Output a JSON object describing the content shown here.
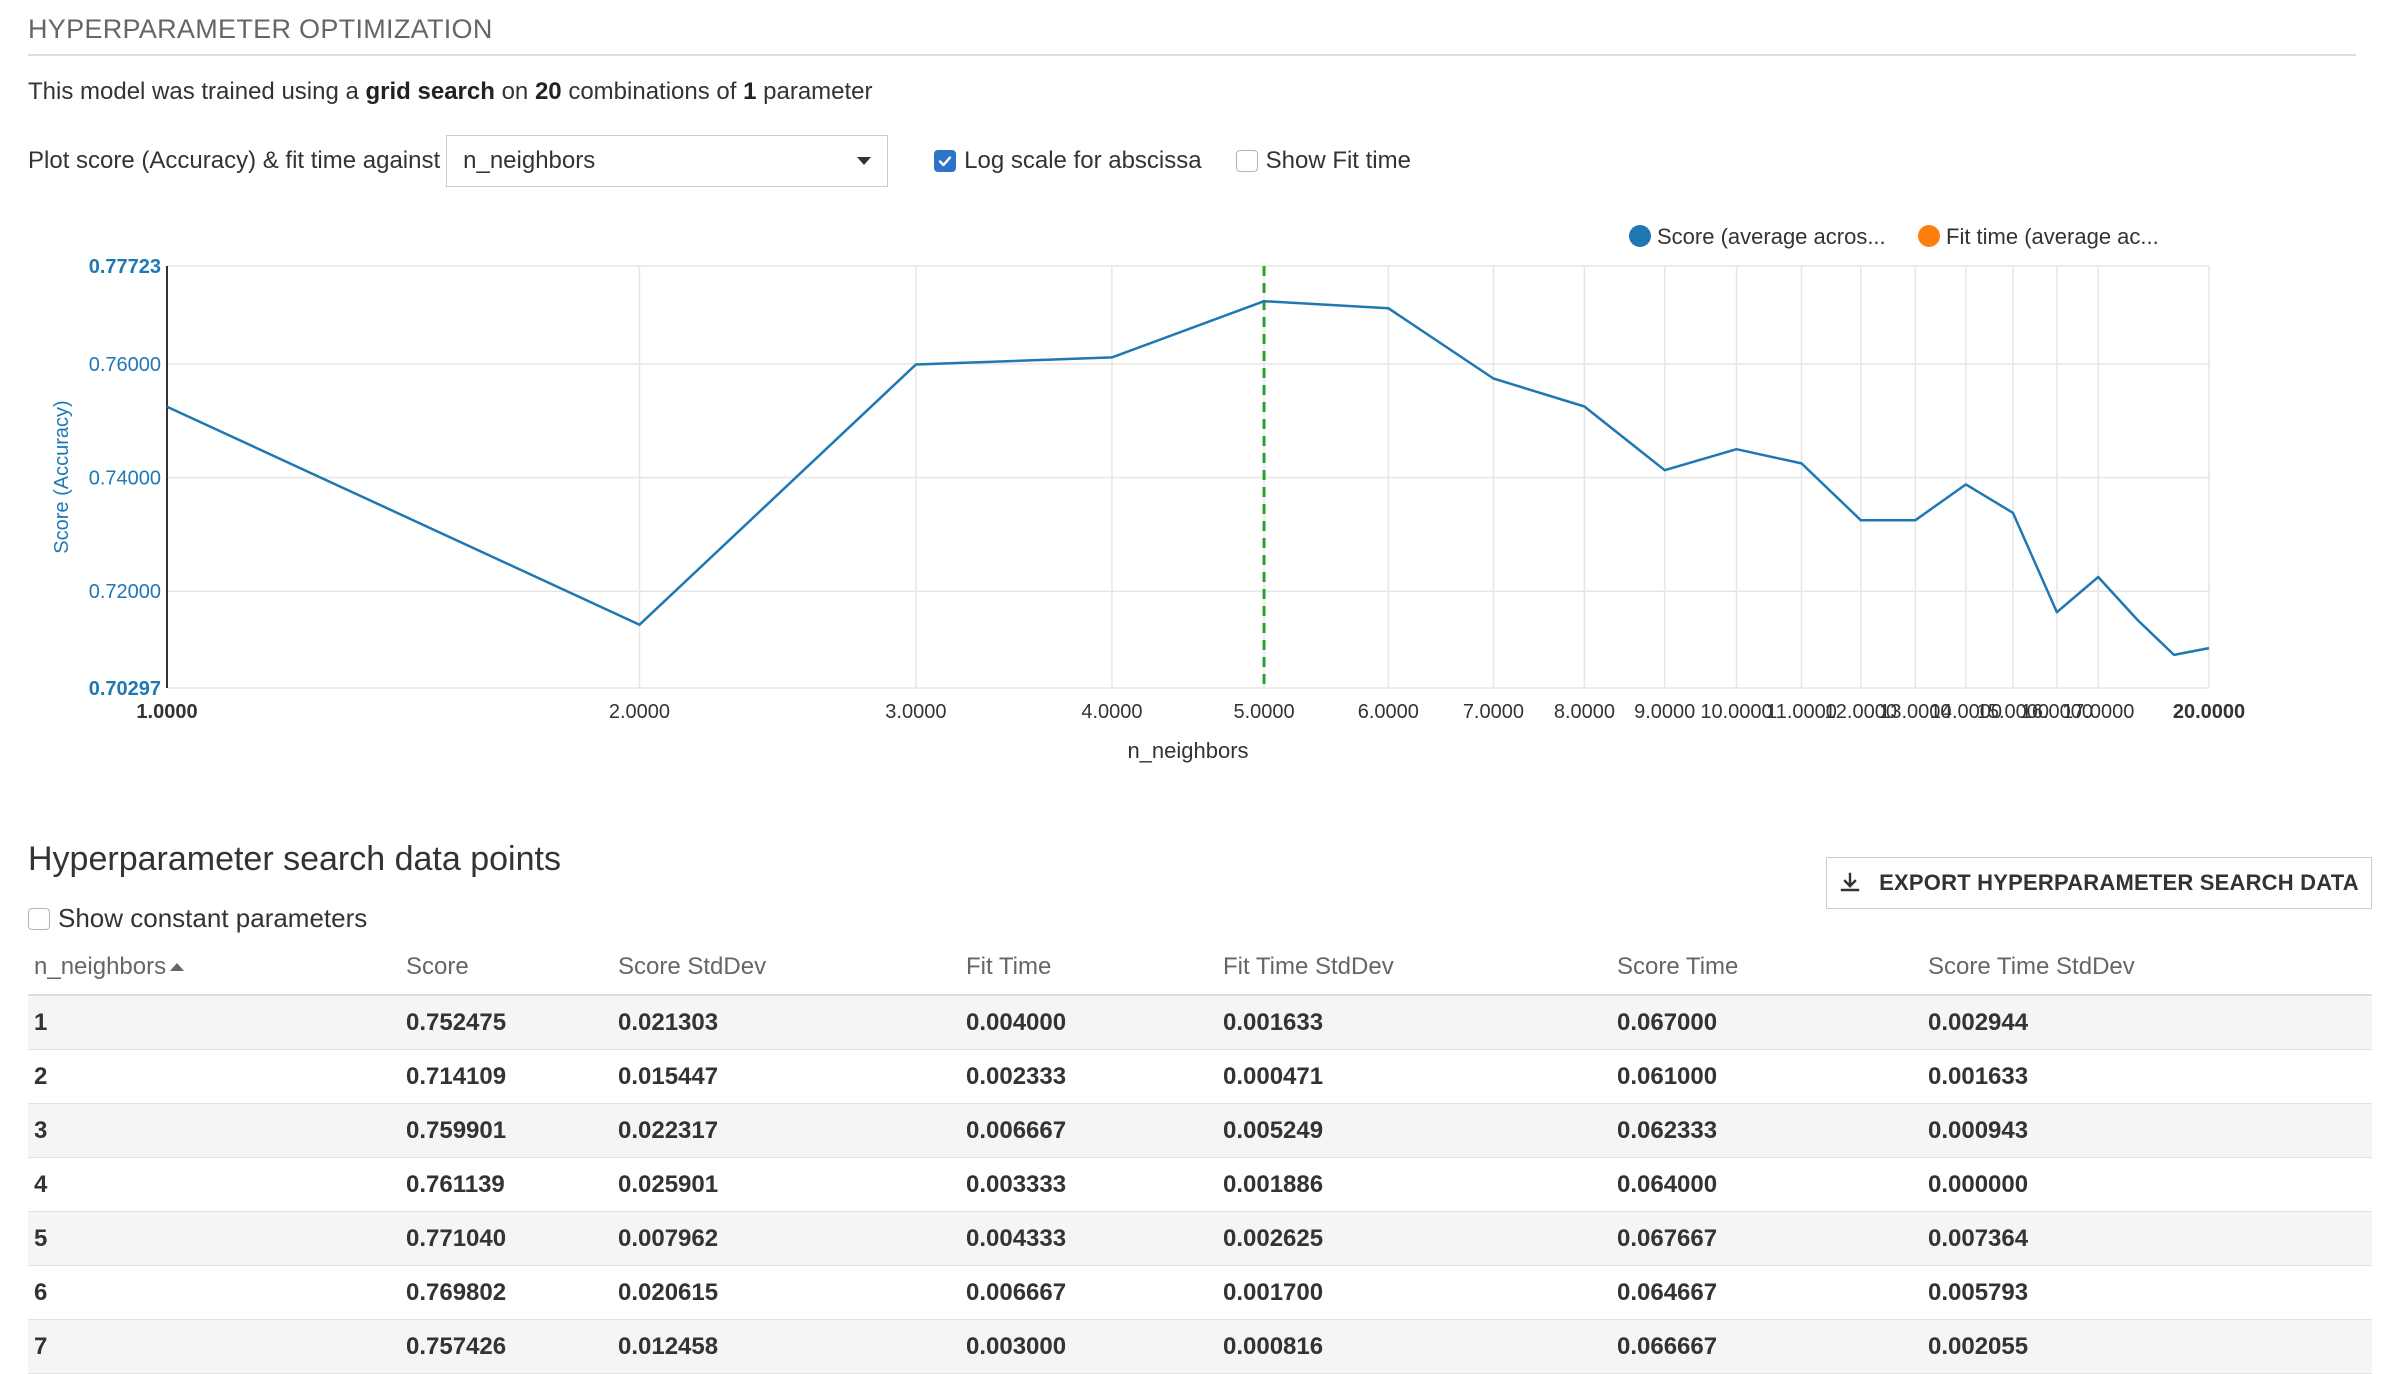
{
  "section_title": "HYPERPARAMETER OPTIMIZATION",
  "summary": {
    "prefix": "This model was trained using a",
    "method": "grid search",
    "on": "on",
    "combinations": "20",
    "middle": "combinations of",
    "parameters": "1",
    "suffix": "parameter"
  },
  "controls": {
    "plot_label": "Plot score (Accuracy) & fit time against",
    "selected_param": "n_neighbors",
    "log_scale_label": "Log scale for abscissa",
    "log_scale_checked": true,
    "show_fit_time_label": "Show Fit time",
    "show_fit_time_checked": false
  },
  "chart_data": {
    "type": "line",
    "xscale": "log",
    "xlabel": "n_neighbors",
    "ylabel": "Score (Accuracy)",
    "xlim": [
      1,
      20
    ],
    "ylim": [
      0.70297,
      0.77723
    ],
    "x_ticks": [
      "1.0000",
      "2.0000",
      "3.0000",
      "4.0000",
      "5.0000",
      "6.0000",
      "7.0000",
      "8.0000",
      "9.0000",
      "10.0000",
      "11.0000",
      "12.0000",
      "13.0000",
      "14.0000",
      "15.0000",
      "16.0000",
      "17.0000",
      "20.0000"
    ],
    "y_ticks": [
      "0.77723",
      "0.76000",
      "0.74000",
      "0.72000",
      "0.70297"
    ],
    "best_x": 5,
    "grid": true,
    "legend_position": "top-right",
    "legend": [
      "Score (average acros...",
      "Fit time (average ac..."
    ],
    "series": [
      {
        "name": "Score (average acros...",
        "color": "#1f77b4",
        "x": [
          1,
          2,
          3,
          4,
          5,
          6,
          7,
          8,
          9,
          10,
          11,
          12,
          13,
          14,
          15,
          16,
          17,
          18,
          19,
          20
        ],
        "values": [
          0.752475,
          0.714109,
          0.759901,
          0.761139,
          0.77104,
          0.769802,
          0.757426,
          0.7525,
          0.7413,
          0.745,
          0.7425,
          0.7325,
          0.7325,
          0.7388,
          0.7338,
          0.7163,
          0.7225,
          0.715,
          0.7088,
          0.71
        ]
      }
    ],
    "fit_time_color": "#ff7f0e",
    "best_line_color": "#2ca02c"
  },
  "table": {
    "subheading": "Hyperparameter search data points",
    "show_constant_label": "Show constant parameters",
    "export_label": "EXPORT HYPERPARAMETER SEARCH DATA",
    "columns": [
      "n_neighbors",
      "Score",
      "Score StdDev",
      "Fit Time",
      "Fit Time StdDev",
      "Score Time",
      "Score Time StdDev"
    ],
    "rows": [
      [
        "1",
        "0.752475",
        "0.021303",
        "0.004000",
        "0.001633",
        "0.067000",
        "0.002944"
      ],
      [
        "2",
        "0.714109",
        "0.015447",
        "0.002333",
        "0.000471",
        "0.061000",
        "0.001633"
      ],
      [
        "3",
        "0.759901",
        "0.022317",
        "0.006667",
        "0.005249",
        "0.062333",
        "0.000943"
      ],
      [
        "4",
        "0.761139",
        "0.025901",
        "0.003333",
        "0.001886",
        "0.064000",
        "0.000000"
      ],
      [
        "5",
        "0.771040",
        "0.007962",
        "0.004333",
        "0.002625",
        "0.067667",
        "0.007364"
      ],
      [
        "6",
        "0.769802",
        "0.020615",
        "0.006667",
        "0.001700",
        "0.064667",
        "0.005793"
      ],
      [
        "7",
        "0.757426",
        "0.012458",
        "0.003000",
        "0.000816",
        "0.066667",
        "0.002055"
      ]
    ]
  }
}
